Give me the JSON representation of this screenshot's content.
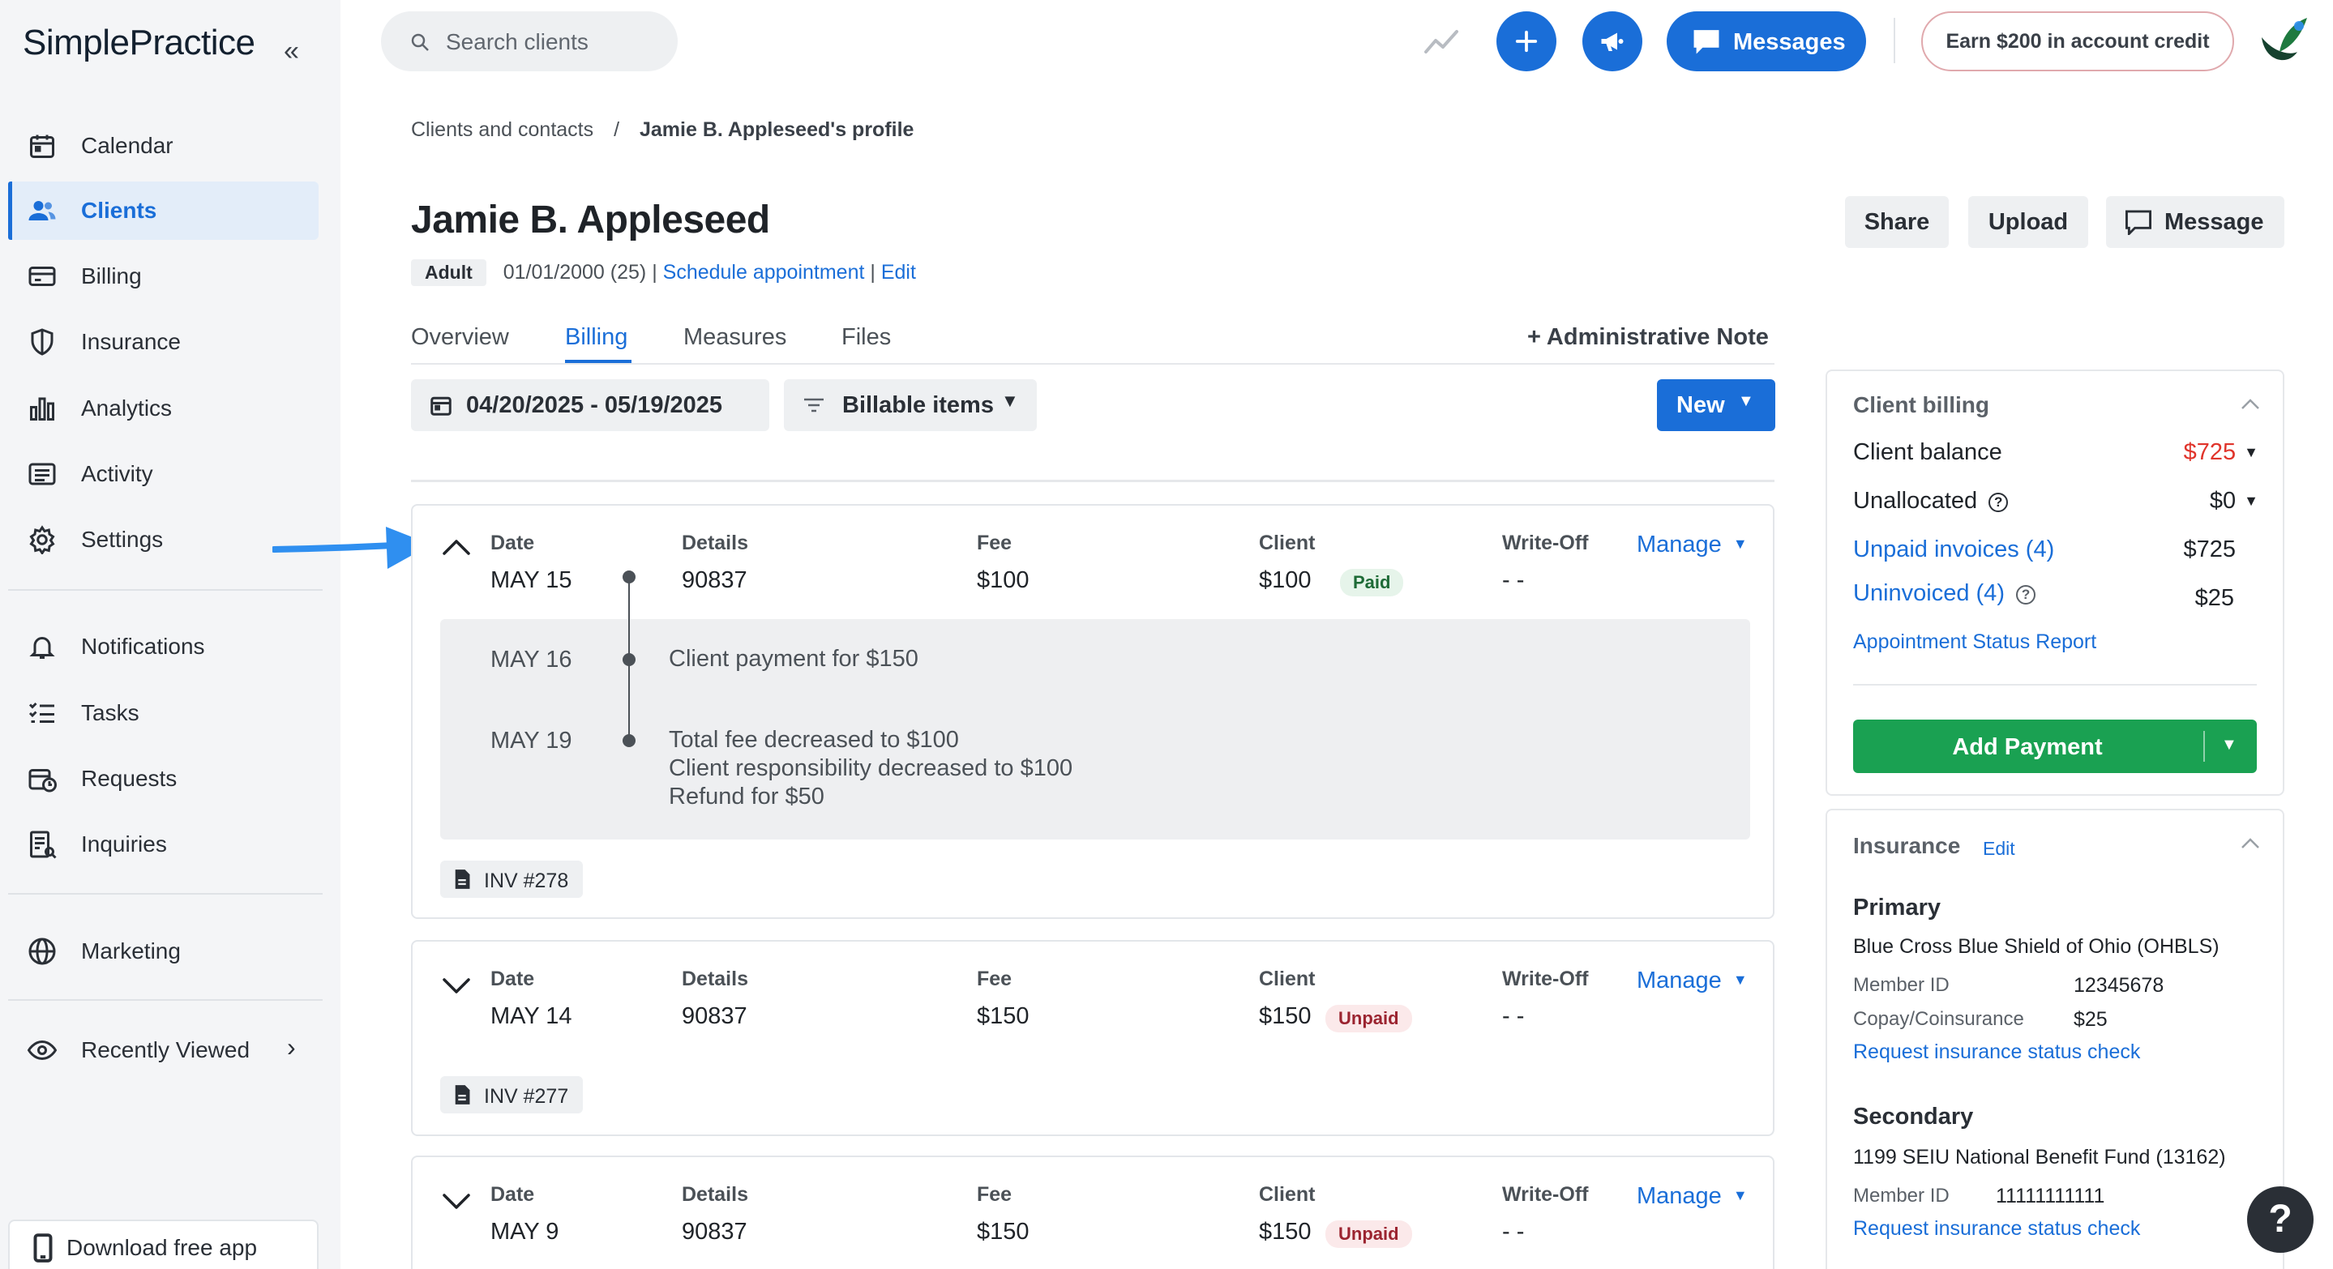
{
  "app": {
    "logo": "SimplePractice"
  },
  "sidebar": {
    "items": [
      {
        "label": "Calendar",
        "icon": "calendar-icon"
      },
      {
        "label": "Clients",
        "icon": "users-icon",
        "active": true
      },
      {
        "label": "Billing",
        "icon": "credit-card-icon"
      },
      {
        "label": "Insurance",
        "icon": "shield-icon"
      },
      {
        "label": "Analytics",
        "icon": "bar-chart-icon"
      },
      {
        "label": "Activity",
        "icon": "list-icon"
      },
      {
        "label": "Settings",
        "icon": "gear-icon"
      },
      {
        "label": "Notifications",
        "icon": "bell-icon"
      },
      {
        "label": "Tasks",
        "icon": "tasks-icon"
      },
      {
        "label": "Requests",
        "icon": "request-icon"
      },
      {
        "label": "Inquiries",
        "icon": "inquiry-icon"
      },
      {
        "label": "Marketing",
        "icon": "globe-icon"
      },
      {
        "label": "Recently Viewed",
        "icon": "eye-icon"
      }
    ],
    "download_label": "Download free app"
  },
  "topbar": {
    "search_placeholder": "Search clients",
    "messages_label": "Messages",
    "earn_label": "Earn $200 in account credit"
  },
  "breadcrumb": {
    "parent": "Clients and contacts",
    "separator": "/",
    "current": "Jamie B. Appleseed's profile"
  },
  "client": {
    "name": "Jamie B. Appleseed",
    "badge": "Adult",
    "dob": "01/01/2000 (25) |",
    "schedule_link": "Schedule appointment",
    "pipe": "|",
    "edit_link": "Edit"
  },
  "actions": {
    "share": "Share",
    "upload": "Upload",
    "message": "Message"
  },
  "tabs": [
    {
      "label": "Overview"
    },
    {
      "label": "Billing",
      "active": true
    },
    {
      "label": "Measures"
    },
    {
      "label": "Files"
    }
  ],
  "admin_note": "+ Administrative Note",
  "filters": {
    "date_range": "04/20/2025 - 05/19/2025",
    "billable": "Billable items",
    "new": "New"
  },
  "columns": {
    "date": "Date",
    "details": "Details",
    "fee": "Fee",
    "client": "Client",
    "writeoff": "Write-Off",
    "manage": "Manage"
  },
  "rows": [
    {
      "date": "MAY 15",
      "details": "90837",
      "fee": "$100",
      "client": "$100",
      "status": "Paid",
      "writeoff": "- -",
      "invoice": "INV #278",
      "history": [
        {
          "date": "MAY 16",
          "lines": [
            "Client payment for $150"
          ]
        },
        {
          "date": "MAY 19",
          "lines": [
            "Total fee decreased to $100",
            "Client responsibility decreased to $100",
            "Refund for $50"
          ]
        }
      ]
    },
    {
      "date": "MAY 14",
      "details": "90837",
      "fee": "$150",
      "client": "$150",
      "status": "Unpaid",
      "writeoff": "- -",
      "invoice": "INV #277"
    },
    {
      "date": "MAY 9",
      "details": "90837",
      "fee": "$150",
      "client": "$150",
      "status": "Unpaid",
      "writeoff": "- -"
    }
  ],
  "client_billing": {
    "title": "Client billing",
    "balance_label": "Client balance",
    "balance_value": "$725",
    "unallocated_label": "Unallocated",
    "unallocated_value": "$0",
    "unpaid_label": "Unpaid invoices (4)",
    "unpaid_value": "$725",
    "uninvoiced_label": "Uninvoiced (4)",
    "uninvoiced_value": "$25",
    "report_link": "Appointment Status Report",
    "add_payment": "Add Payment"
  },
  "insurance": {
    "title": "Insurance",
    "edit": "Edit",
    "primary": {
      "heading": "Primary",
      "name": "Blue Cross Blue Shield of Ohio (OHBLS)",
      "member_label": "Member ID",
      "member_id": "12345678",
      "copay_label": "Copay/Coinsurance",
      "copay": "$25",
      "check": "Request insurance status check"
    },
    "secondary": {
      "heading": "Secondary",
      "name": "1199 SEIU National Benefit Fund (13162)",
      "member_label": "Member ID",
      "member_id": "11111111111",
      "check": "Request insurance status check"
    }
  },
  "colors": {
    "accent": "#1a6ed8",
    "balance_due": "#e0342b",
    "paid": "#1e6b37",
    "unpaid": "#9b2430",
    "add_payment": "#1aa152"
  },
  "help_label": "?"
}
